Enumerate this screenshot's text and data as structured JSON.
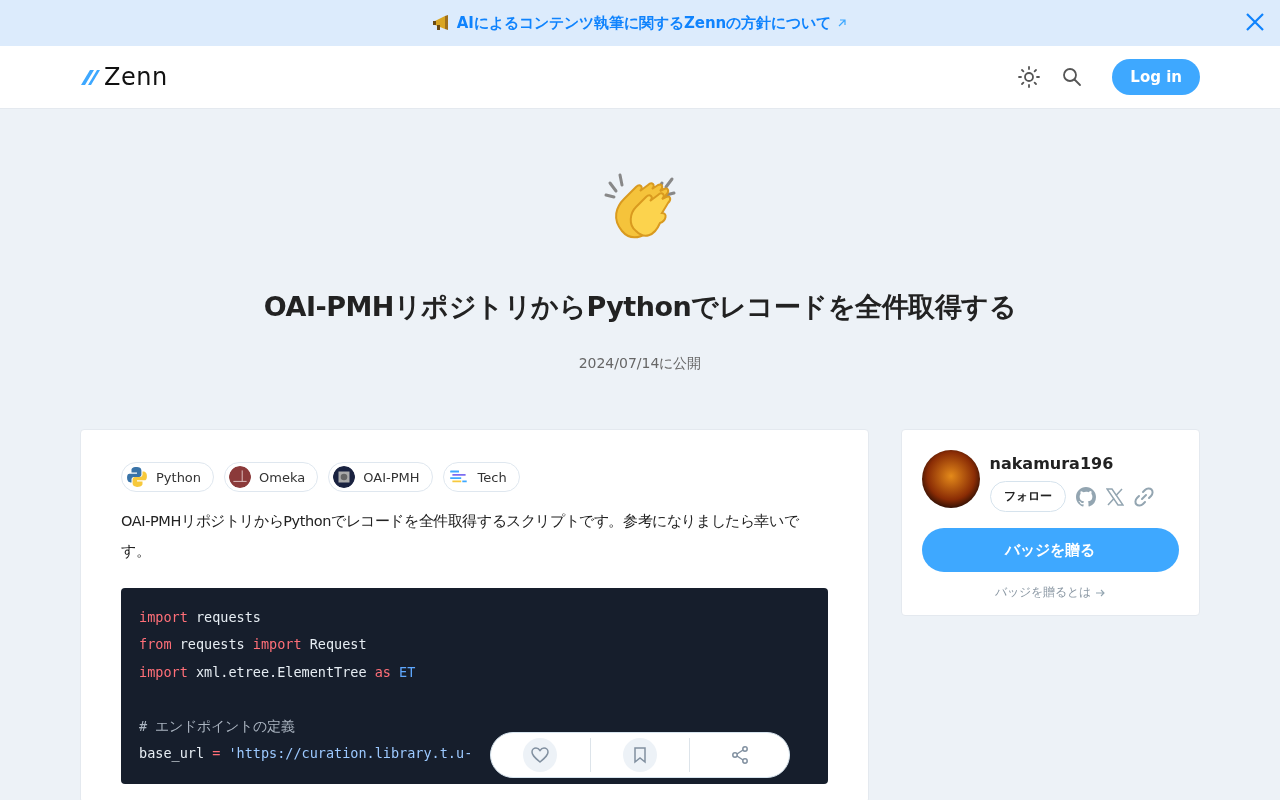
{
  "announcement": {
    "text": "AIによるコンテンツ執筆に関するZennの方針について",
    "external": true
  },
  "header": {
    "logo": "Zenn",
    "login": "Log in"
  },
  "article": {
    "title": "OAI-PMHリポジトリからPythonでレコードを全件取得する",
    "published": "2024/07/14に公開"
  },
  "topics": [
    {
      "label": "Python"
    },
    {
      "label": "Omeka"
    },
    {
      "label": "OAI-PMH"
    },
    {
      "label": "Tech"
    }
  ],
  "intro": "OAI-PMHリポジトリからPythonでレコードを全件取得するスクリプトです。参考になりましたら幸いです。",
  "code_lines": [
    {
      "tokens": [
        {
          "kind": "keyword",
          "text": "import"
        },
        {
          "kind": "plain",
          "text": " requests"
        }
      ]
    },
    {
      "tokens": [
        {
          "kind": "keyword",
          "text": "from"
        },
        {
          "kind": "plain",
          "text": " requests "
        },
        {
          "kind": "keyword",
          "text": "import"
        },
        {
          "kind": "plain",
          "text": " Request"
        }
      ]
    },
    {
      "tokens": [
        {
          "kind": "keyword",
          "text": "import"
        },
        {
          "kind": "plain",
          "text": " xml.etree.ElementTree "
        },
        {
          "kind": "keyword",
          "text": "as"
        },
        {
          "kind": "builtin",
          "text": " ET"
        }
      ]
    },
    {
      "blank": true
    },
    {
      "tokens": [
        {
          "kind": "comment",
          "text": "# エンドポイントの定義"
        }
      ]
    },
    {
      "tokens": [
        {
          "kind": "plain",
          "text": "base_url "
        },
        {
          "kind": "keyword",
          "text": "="
        },
        {
          "kind": "string",
          "text": " 'https://curation.library.t.u-"
        }
      ]
    }
  ],
  "author": {
    "name": "nakamura196",
    "follow": "フォロー",
    "badge_button": "バッジを贈る",
    "badge_link": "バッジを贈るとは"
  }
}
